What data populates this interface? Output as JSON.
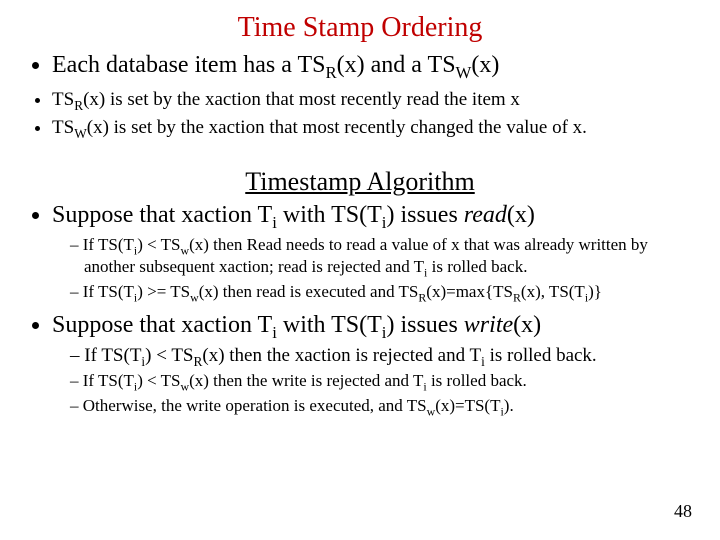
{
  "title": "Time Stamp Ordering",
  "bullets": {
    "item1_pre": "Each database item has a TS",
    "item1_mid1": "(x) and a TS",
    "item1_post": "(x)",
    "R": "R",
    "W": "W",
    "item2_pre": "TS",
    "item2_post": "(x)  is set by the xaction that most recently read the item x",
    "item3_pre": "TS",
    "item3_post": "(x) is set by the xaction that most recently changed the value of x."
  },
  "subtitle": "Timestamp Algorithm",
  "algo": {
    "read_pre": "Suppose that xaction T",
    "i": "i",
    "read_mid": "  with TS(T",
    "read_post": ") issues ",
    "read_op": "read",
    "read_x": "(x)",
    "read_rule1_a": "If TS(T",
    "read_rule1_b": ") < TS",
    "w": "w",
    "read_rule1_c": "(x) then Read needs to read a value of x that was already written by another subsequent xaction; read is rejected and T",
    "read_rule1_d": " is rolled back.",
    "read_rule2_a": "If TS(T",
    "read_rule2_b": ") >= TS",
    "read_rule2_c": "(x) then read is executed and TS",
    "R2": "R",
    "read_rule2_d": "(x)=max{TS",
    "read_rule2_e": "(x), TS(T",
    "read_rule2_f": ")}",
    "write_pre": "Suppose that xaction T",
    "write_mid": "  with TS(T",
    "write_post": ") issues ",
    "write_op": "write",
    "write_x": "(x)",
    "write_rule1_a": "If ",
    "write_rule1_b": "TS(T",
    "write_rule1_c": ") < TS",
    "write_rule1_d": "(x) then the xaction is rejected and T",
    "write_rule1_e": " is rolled back.",
    "write_rule2_a": "If TS(T",
    "write_rule2_b": ") < TS",
    "write_rule2_c": "(x) then the write is rejected and T",
    "write_rule2_d": " is rolled back.",
    "write_rule3_a": "Otherwise, the write operation is executed, and TS",
    "write_rule3_b": "(x)=TS(T",
    "write_rule3_c": ")."
  },
  "page": "48"
}
